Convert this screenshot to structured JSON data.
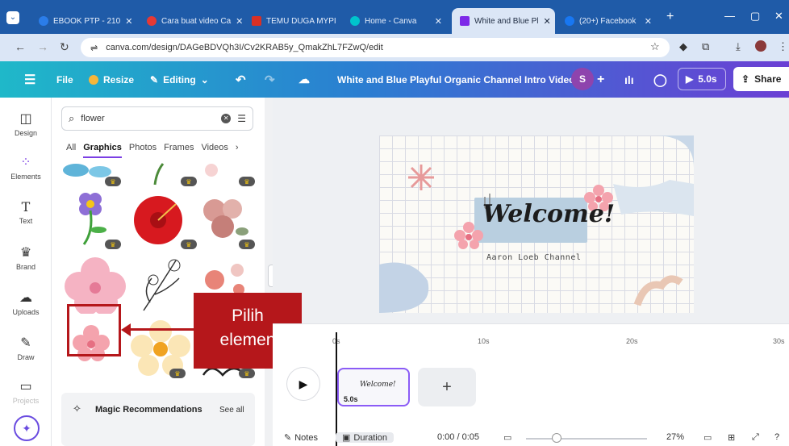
{
  "browser": {
    "tabs": [
      {
        "label": "EBOOK PTP - 210",
        "icon": "gdrive-icon",
        "color": "#2b7de9"
      },
      {
        "label": "Cara buat video Ca",
        "icon": "youtube-icon",
        "color": "#e53935"
      },
      {
        "label": "TEMU DUGA MYPI",
        "icon": "gmail-icon",
        "color": "#d93025"
      },
      {
        "label": "Home - Canva",
        "icon": "canva-icon",
        "color": "#00c4cc"
      },
      {
        "label": "White and Blue Pl",
        "icon": "canva-video-icon",
        "color": "#7d2ae8"
      },
      {
        "label": "(20+) Facebook",
        "icon": "facebook-icon",
        "color": "#1877f2"
      }
    ],
    "new_tab": "+",
    "url": "canva.com/design/DAGeBDVQh3I/Cv2KRAB5y_QmakZhL7FZwQ/edit"
  },
  "topbar": {
    "file": "File",
    "resize": "Resize",
    "editing": "Editing",
    "title": "White and Blue Playful Organic Channel Intro Video",
    "avatar": "S",
    "play_duration": "5.0s",
    "share": "Share"
  },
  "rail": [
    {
      "label": "Design",
      "icon": "design-icon",
      "glyph": "◫"
    },
    {
      "label": "Elements",
      "icon": "elements-icon",
      "glyph": "⁘"
    },
    {
      "label": "Text",
      "icon": "text-icon",
      "glyph": "T"
    },
    {
      "label": "Brand",
      "icon": "brand-icon",
      "glyph": "♛"
    },
    {
      "label": "Uploads",
      "icon": "uploads-icon",
      "glyph": "☁"
    },
    {
      "label": "Draw",
      "icon": "draw-icon",
      "glyph": "✎"
    },
    {
      "label": "Projects",
      "icon": "projects-icon",
      "glyph": "▭"
    }
  ],
  "panel": {
    "search_value": "flower",
    "tabs": [
      "All",
      "Graphics",
      "Photos",
      "Frames",
      "Videos"
    ],
    "active_tab": "Graphics",
    "magic_label": "Magic Recommendations",
    "see_all": "See all"
  },
  "annotation": {
    "callout_line1": "Pilih",
    "callout_line2": "elemen"
  },
  "design": {
    "welcome": "Welcome!",
    "subtitle": "Aaron Loeb Channel"
  },
  "timeline": {
    "ticks": [
      "0s",
      "10s",
      "20s",
      "30s"
    ],
    "clip_duration": "5.0s",
    "add": "+"
  },
  "footer": {
    "notes": "Notes",
    "duration": "Duration",
    "time": "0:00 / 0:05",
    "zoom": "27%"
  },
  "colors": {
    "accent": "#7b3fe4",
    "annotation_red": "#b5171b",
    "topbar_start": "#1fb8c9",
    "topbar_end": "#6b3fd4"
  }
}
